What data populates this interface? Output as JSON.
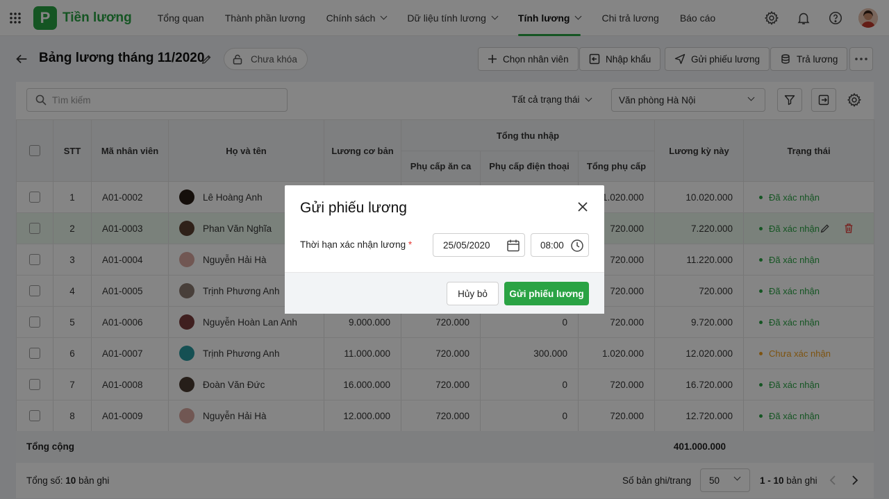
{
  "app": {
    "name": "Tiền lương",
    "logo_letter": "P",
    "brand_color": "#2aa344"
  },
  "nav": {
    "items": [
      {
        "label": "Tổng quan"
      },
      {
        "label": "Thành phần lương"
      },
      {
        "label": "Chính sách"
      },
      {
        "label": "Dữ liệu tính lương"
      },
      {
        "label": "Tính lương"
      },
      {
        "label": "Chi trả lương"
      },
      {
        "label": "Báo cáo"
      }
    ],
    "active": "Tính lương"
  },
  "page": {
    "title": "Bảng lương tháng 11/2020",
    "lock_status": "Chưa khóa",
    "actions": {
      "select_employee": "Chọn nhân viên",
      "import": "Nhập khẩu",
      "send_payslip": "Gửi phiếu lương",
      "pay": "Trả lương"
    }
  },
  "toolbar": {
    "search_placeholder": "Tìm kiếm",
    "status_filter": "Tất cả trạng thái",
    "office": "Văn phòng Hà Nội"
  },
  "table": {
    "headers": {
      "stt": "STT",
      "code": "Mã nhân viên",
      "name": "Họ và tên",
      "base": "Lương cơ bản",
      "income_group": "Tổng thu nhập",
      "meal": "Phụ cấp ăn ca",
      "phone": "Phụ cấp điện thoại",
      "total_allow": "Tổng phụ cấp",
      "pay": "Lương kỳ này",
      "status": "Trạng thái"
    },
    "rows": [
      {
        "stt": "1",
        "code": "A01-0002",
        "name": "Lê Hoàng Anh",
        "base": "",
        "meal": "",
        "phone": "",
        "total_allow": "1.020.000",
        "pay": "10.020.000",
        "status": "Đã xác nhận"
      },
      {
        "stt": "2",
        "code": "A01-0003",
        "name": "Phan Văn Nghĩa",
        "base": "",
        "meal": "",
        "phone": "",
        "total_allow": "720.000",
        "pay": "7.220.000",
        "status": "Đã xác nhận"
      },
      {
        "stt": "3",
        "code": "A01-0004",
        "name": "Nguyễn Hải Hà",
        "base": "",
        "meal": "",
        "phone": "",
        "total_allow": "720.000",
        "pay": "11.220.000",
        "status": "Đã xác nhận"
      },
      {
        "stt": "4",
        "code": "A01-0005",
        "name": "Trịnh Phương Anh",
        "base": "",
        "meal": "",
        "phone": "",
        "total_allow": "720.000",
        "pay": "720.000",
        "status": "Đã xác nhận"
      },
      {
        "stt": "5",
        "code": "A01-0006",
        "name": "Nguyễn Hoàn Lan Anh",
        "base": "9.000.000",
        "meal": "720.000",
        "phone": "0",
        "total_allow": "720.000",
        "pay": "9.720.000",
        "status": "Đã xác nhận"
      },
      {
        "stt": "6",
        "code": "A01-0007",
        "name": "Trịnh Phương Anh",
        "base": "11.000.000",
        "meal": "720.000",
        "phone": "300.000",
        "total_allow": "1.020.000",
        "pay": "12.020.000",
        "status": "Chưa xác nhận"
      },
      {
        "stt": "7",
        "code": "A01-0008",
        "name": "Đoàn Văn Đức",
        "base": "16.000.000",
        "meal": "720.000",
        "phone": "0",
        "total_allow": "720.000",
        "pay": "16.720.000",
        "status": "Đã xác nhận"
      },
      {
        "stt": "8",
        "code": "A01-0009",
        "name": "Nguyễn Hải Hà",
        "base": "12.000.000",
        "meal": "720.000",
        "phone": "0",
        "total_allow": "720.000",
        "pay": "12.720.000",
        "status": "Đã xác nhận"
      }
    ],
    "total_label": "Tổng cộng",
    "total_pay": "401.000.000"
  },
  "footer": {
    "total_prefix": "Tổng số:",
    "total_count": "10",
    "total_suffix": "bản ghi",
    "per_page_label": "Số bản ghi/trang",
    "per_page": "50",
    "range": "1 - 10",
    "range_suffix": "bản ghi"
  },
  "modal": {
    "title": "Gửi phiếu lương",
    "field_label": "Thời hạn xác nhận lương",
    "required_mark": "*",
    "date": "25/05/2020",
    "time": "08:00",
    "cancel": "Hủy bỏ",
    "submit": "Gửi phiếu lương"
  },
  "colors": {
    "confirmed": "#2aa344",
    "pending": "#f0a020"
  }
}
